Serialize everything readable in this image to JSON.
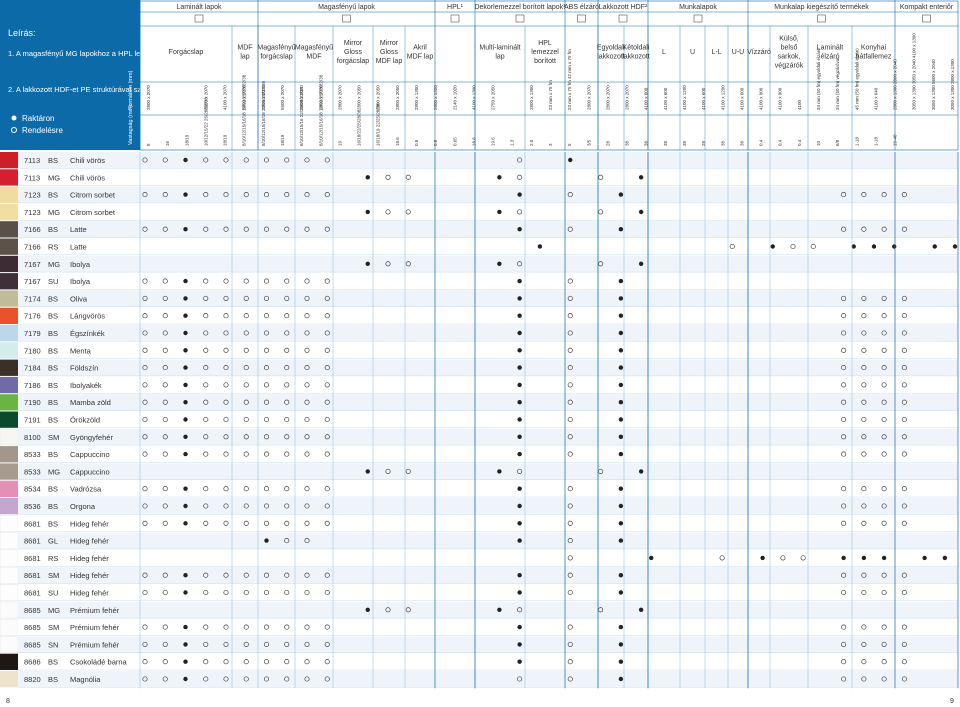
{
  "legend": {
    "title": "Leírás:",
    "notes": [
      "1.  A magasfényű MG lapokhoz a HPL lemezeket SQ struktúrával szállítjuk.",
      "2.  A lakkozott HDF-et PE struktúrával szállítjuk."
    ],
    "stock_label": "Raktáron",
    "order_label": "Rendelésre"
  },
  "row_labels": {
    "format": "Formátum (mm)",
    "thickness": "Vastagság (mm)"
  },
  "groups": [
    "Laminált lapok",
    "Magasfényű lapok",
    "HPL¹",
    "Dekorlemezzel borított lapok¹",
    "ABS élzáró",
    "Lakkozott HDF²",
    "Munkalapok",
    "Munkalap kiegészítő termékek",
    "Kompakt enteriőr"
  ],
  "subheaders": [
    {
      "label": "Forgácslap"
    },
    {
      "label": "MDF lap"
    },
    {
      "label": "Magasfényű forgácslap"
    },
    {
      "label": "Magasfényű MDF"
    },
    {
      "label": "Mirror Gloss forgácslap"
    },
    {
      "label": "Mirror Gloss MDF lap"
    },
    {
      "label": "Akril MDF lap"
    },
    {
      "label": "Multi-laminált lap"
    },
    {
      "label": "HPL lemezzel borított"
    },
    {
      "label": "Egyoldali lakkozott"
    },
    {
      "label": "Kétoldali lakkozott"
    },
    {
      "label": "L"
    },
    {
      "label": "U"
    },
    {
      "label": "L-L"
    },
    {
      "label": "U-U"
    },
    {
      "label": "Vízzáró"
    },
    {
      "label": "Külső, belső sarkok, végzárók"
    },
    {
      "label": "Laminált élzáró"
    },
    {
      "label": "Konyhai hátfallemez"
    }
  ],
  "col_formats": [
    "2800 x 2070",
    "",
    "",
    "3050 x 2070",
    "4100 x 2070",
    "5600 x 2070",
    "2800 x 2070",
    "5600 x 2070",
    "2800 x 2070",
    "2800 x 2070",
    "2800 x 2070",
    "2800 x 2050",
    "2800 x 2050",
    "2800 x 2050",
    "2800 x 1300",
    "2800 x 1320",
    "2140 x 1020",
    "4100 x 1300",
    "2750 x 2050",
    "",
    "2800 x 1300",
    "23 mm x 75 fm",
    "23 mm x 75 fm 42 mm x 75 fm",
    "2800 x 2070",
    "2800 x 2070",
    "2800 x 2070",
    "4100 x 600",
    "4100 x 600",
    "4100 x 1200",
    "4100 x 600",
    "4100 x 1200",
    "4100 x 600",
    "4100 x 900",
    "4100 x 900",
    "4100",
    "34 mm (50 fm) egyoldali élzáró",
    "34 mm (50 fm) végzáróval",
    "45 mm (50 fm) egyoldali élzáró",
    "4100 x 640",
    "2800 x 1300 2800 x 2040",
    "3050 x 1300 3050 x 2040 4100 x 1300",
    "3050 x 1300 5600 x 2040",
    "3050 x 1300 2800 x 1300"
  ],
  "col_thickness": [
    "8",
    "16",
    "18/19",
    "10/12/15/22 25/28/32/38",
    "18/19",
    "8/10/12/15/16/18 19/22/25/28/32/38",
    "8/10/12/15/16/18 22/25/28/32/38",
    "18/19",
    "8/10/12/15/16 22/25/28/32/38",
    "8/10/12/15/16/18 19/22/25/28/32/38",
    "19",
    "16/18/22/25/28/38",
    "16/18/19 22/25/28/38",
    "18.6",
    "0.8",
    "0.8",
    "0.65",
    "18.6",
    "19.6",
    "1.3",
    "2.0",
    "3",
    "5",
    "3/5",
    "28",
    "38",
    "38",
    "38",
    "38",
    "28",
    "38",
    "38",
    "0.4",
    "0.4",
    "0.4",
    "10",
    "6/8",
    "1-18",
    "1-18",
    "19-40"
  ],
  "rows": [
    {
      "code": "7113",
      "type": "BS",
      "name": "Chili vörös",
      "color": "#cc1f2a"
    },
    {
      "code": "7113",
      "type": "MG",
      "name": "Chili vörös",
      "color": "#d4202e"
    },
    {
      "code": "7123",
      "type": "BS",
      "name": "Citrom sorbet",
      "color": "#efdc9e"
    },
    {
      "code": "7123",
      "type": "MG",
      "name": "Citrom sorbet",
      "color": "#f1dea0"
    },
    {
      "code": "7166",
      "type": "BS",
      "name": "Latte",
      "color": "#5b5048"
    },
    {
      "code": "7166",
      "type": "RS",
      "name": "Latte",
      "color": "#5d524a"
    },
    {
      "code": "7167",
      "type": "MG",
      "name": "Ibolya",
      "color": "#3e2c35"
    },
    {
      "code": "7167",
      "type": "SU",
      "name": "Ibolya",
      "color": "#3f2f38"
    },
    {
      "code": "7174",
      "type": "BS",
      "name": "Oliva",
      "color": "#c0bc9a"
    },
    {
      "code": "7176",
      "type": "BS",
      "name": "Lángvörös",
      "color": "#e8532b"
    },
    {
      "code": "7179",
      "type": "BS",
      "name": "Égszínkék",
      "color": "#bcd6ea"
    },
    {
      "code": "7180",
      "type": "BS",
      "name": "Menta",
      "color": "#d3ecec"
    },
    {
      "code": "7184",
      "type": "BS",
      "name": "Földszín",
      "color": "#3b2f2a"
    },
    {
      "code": "7186",
      "type": "BS",
      "name": "Ibolyakék",
      "color": "#6f6aa8"
    },
    {
      "code": "7190",
      "type": "BS",
      "name": "Mamba zöld",
      "color": "#6ab446"
    },
    {
      "code": "7191",
      "type": "BS",
      "name": "Örökzöld",
      "color": "#0b4a2c"
    },
    {
      "code": "8100",
      "type": "SM",
      "name": "Gyöngyfehér",
      "color": "#f6f6f3"
    },
    {
      "code": "8533",
      "type": "BS",
      "name": "Cappuccino",
      "color": "#a4968b"
    },
    {
      "code": "8533",
      "type": "MG",
      "name": "Cappuccino",
      "color": "#a79a8f"
    },
    {
      "code": "8534",
      "type": "BS",
      "name": "Vadrózsa",
      "color": "#e48fb6"
    },
    {
      "code": "8536",
      "type": "BS",
      "name": "Orgona",
      "color": "#c3a7cf"
    },
    {
      "code": "8681",
      "type": "BS",
      "name": "Hideg fehér",
      "color": "#fdfdfd"
    },
    {
      "code": "8681",
      "type": "GL",
      "name": "Hideg fehér",
      "color": "#fdfdfd"
    },
    {
      "code": "8681",
      "type": "RS",
      "name": "Hideg fehér",
      "color": "#fdfdfd"
    },
    {
      "code": "8681",
      "type": "SM",
      "name": "Hideg fehér",
      "color": "#fdfdfd"
    },
    {
      "code": "8681",
      "type": "SU",
      "name": "Hideg fehér",
      "color": "#fdfdfd"
    },
    {
      "code": "8685",
      "type": "MG",
      "name": "Prémium fehér",
      "color": "#fbfbfb"
    },
    {
      "code": "8685",
      "type": "SM",
      "name": "Prémium fehér",
      "color": "#fbfbfb"
    },
    {
      "code": "8685",
      "type": "SN",
      "name": "Prémium fehér",
      "color": "#fbfbfb"
    },
    {
      "code": "8686",
      "type": "BS",
      "name": "Csokoládé barna",
      "color": "#1f1714"
    },
    {
      "code": "8820",
      "type": "BS",
      "name": "Magnólia",
      "color": "#eee4cd"
    }
  ],
  "marks": [
    "o o ● o o o o o o o                  o    ●                              ",
    "                      ● o o        ● o       o   ●                           ",
    "o o ● o o o o o o o                  ●    o    ●                     o o o o ",
    "                      ● o o        ● o       o   ●                           ",
    "o o ● o o o o o o o                  ●    o    ●                     o o o o ",
    "                                       ●                  o   ● o o   ● ● ●   ● ●",
    "                      ● o o        ● o       o   ●                           ",
    "o o ● o o o o o o o                  ●    o    ●                             ",
    "o o ● o o o o o o o                  ●    o    ●                     o o o o ",
    "o o ● o o o o o o o                  ●    o    ●                     o o o o ",
    "o o ● o o o o o o o                  ●    o    ●                     o o o o ",
    "o o ● o o o o o o o                  ●    o    ●                     o o o o ",
    "o o ● o o o o o o o                  ●    o    ●                     o o o o ",
    "o o ● o o o o o o o                  ●    o    ●                     o o o o ",
    "o o ● o o o o o o o                  ●    o    ●                     o o o o ",
    "o o ● o o o o o o o                  ●    o    ●                     o o o o ",
    "o o ● o o o o o o o                  ●    o    ●                     o o o o ",
    "o o ● o o o o o o o                  ●    o    ●                     o o o o ",
    "                      ● o o        ● o       o   ●                           ",
    "o o ● o o o o o o o                  ●    o    ●                     o o o o ",
    "o o ● o o o o o o o                  ●    o    ●                     o o o o ",
    "o o ● o o o o o o o                  ●    o    ●                     o o o o ",
    "            ● o o                    ●    o    ●                             ",
    "                                          o       ●      o   ● o o   ● ● ●   ● ●",
    "o o ● o o o o o o o                  ●    o    ●                     o o o o ",
    "o o ● o o o o o o o                  ●    o    ●                     o o o o ",
    "                      ● o o        ● o       o   ●                           ",
    "o o ● o o o o o o o                  ●    o    ●                     o o o o ",
    "o o ● o o o o o o o                  ●    o    ●                     o o o o ",
    "o o ● o o o o o o o                  ●    o    ●                     o o o o ",
    "o o ● o o o o o o o                  o    o    ●                     o o o o "
  ],
  "page_numbers": {
    "left": "8",
    "right": "9"
  }
}
